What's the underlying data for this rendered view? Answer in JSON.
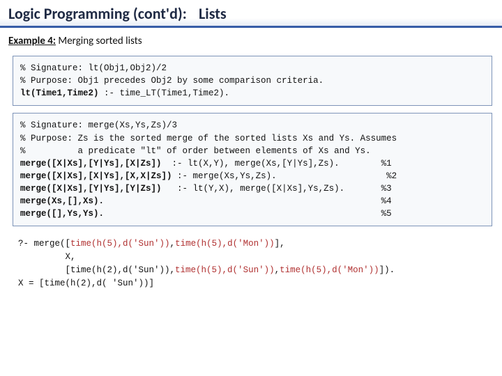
{
  "title": {
    "part1": "Logic Programming (cont'd):",
    "part2": "Lists"
  },
  "subtitle": {
    "label": "Example 4:",
    "text": "  Merging sorted lists"
  },
  "code1": {
    "l1": "% Signature: lt(Obj1,Obj2)/2",
    "l2": "% Purpose: Obj1 precedes Obj2 by some comparison criteria.",
    "l3a": "lt(Time1,Time2)",
    "l3b": " :- time_LT(Time1,Time2)."
  },
  "code2": {
    "l1": "% Signature: merge(Xs,Ys,Zs)/3",
    "l2": "% Purpose: Zs is the sorted merge of the sorted lists Xs and Ys. Assumes",
    "l3": "%          a predicate \"lt\" of order between elements of Xs and Ys.",
    "l4a": "merge([X|Xs],[Y|Ys],[X|Zs])",
    "l4b": "  :- lt(X,Y), merge(Xs,[Y|Ys],Zs).        %1",
    "l5a": "merge([X|Xs],[X|Ys],[X,X|Zs])",
    "l5b": " :- merge(Xs,Ys,Zs).                     %2",
    "l6a": "merge([X|Xs],[Y|Ys],[Y|Zs])",
    "l6b": "   :- lt(Y,X), merge([X|Xs],Ys,Zs).       %3",
    "l7a": "merge(Xs,[],Xs).",
    "l7b": "                                                     %4",
    "l8a": "merge([],Ys,Ys).",
    "l8b": "                                                     %5"
  },
  "query": {
    "l1a": "?- merge([",
    "l1b": "time(h(5),d('Sun'))",
    "l1c": ",",
    "l1d": "time(h(5),d('Mon'))",
    "l1e": "],",
    "l2": "         X,",
    "l3a": "         [time(h(2),d('Sun')),",
    "l3b": "time(h(5),d('Sun'))",
    "l3c": ",",
    "l3d": "time(h(5),d('Mon'))",
    "l3e": "]).",
    "l4": "X = [time(h(2),d( 'Sun'))]"
  }
}
